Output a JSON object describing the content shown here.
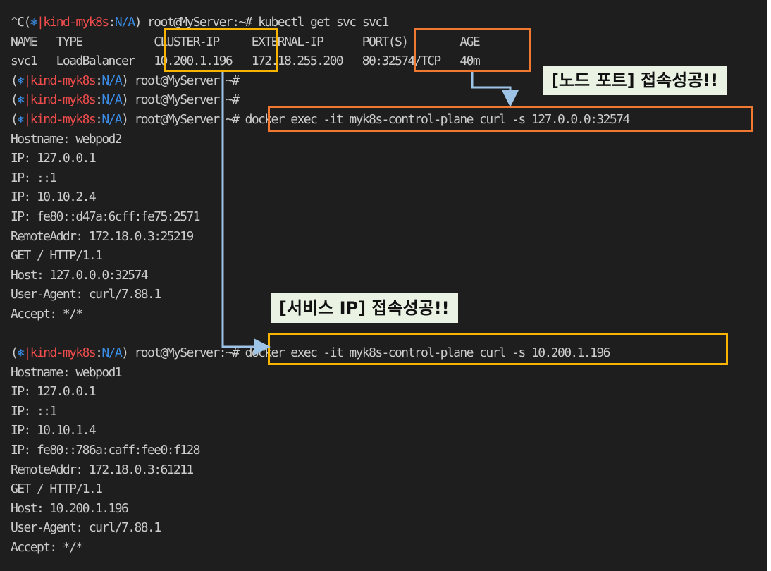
{
  "terminal": {
    "lines": [
      "^C(⎈|kind-myk8s:N/A) root@MyServer:~# kubectl get svc svc1",
      "NAME   TYPE           CLUSTER-IP     EXTERNAL-IP      PORT(S)        AGE",
      "svc1   LoadBalancer   10.200.1.196   172.18.255.200   80:32574/TCP   40m",
      "(⎈|kind-myk8s:N/A) root@MyServer:~#",
      "(⎈|kind-myk8s:N/A) root@MyServer:~#",
      "(⎈|kind-myk8s:N/A) root@MyServer:~# docker exec -it myk8s-control-plane curl -s 127.0.0.0:32574",
      "Hostname: webpod2",
      "IP: 127.0.0.1",
      "IP: ::1",
      "IP: 10.10.2.4",
      "IP: fe80::d47a:6cff:fe75:2571",
      "RemoteAddr: 172.18.0.3:25219",
      "GET / HTTP/1.1",
      "Host: 127.0.0.0:32574",
      "User-Agent: curl/7.88.1",
      "Accept: */*",
      "",
      "(⎈|kind-myk8s:N/A) root@MyServer:~# docker exec -it myk8s-control-plane curl -s 10.200.1.196",
      "Hostname: webpod1",
      "IP: 127.0.0.1",
      "IP: ::1",
      "IP: 10.10.1.4",
      "IP: fe80::786a:caff:fee0:f128",
      "RemoteAddr: 172.18.0.3:61211",
      "GET / HTTP/1.1",
      "Host: 10.200.1.196",
      "User-Agent: curl/7.88.1",
      "Accept: */*"
    ]
  },
  "callouts": {
    "node_port": "[노드 포트] 접속성공!!",
    "service_ip": "[서비스 IP] 접속성공!!"
  },
  "colors": {
    "background": "#1e1e1e",
    "text": "#cccccc",
    "prompt_context": "#f14c4c",
    "prompt_na": "#3b8eea",
    "box_orange": "#f07830",
    "box_yellow": "#f8b400",
    "arrow": "#9dc3e6",
    "callout_bg": "#e9f2e3"
  }
}
